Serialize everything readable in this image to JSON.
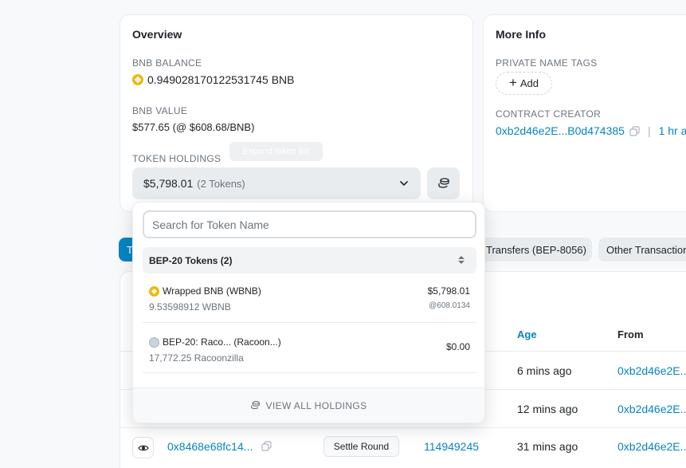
{
  "overview": {
    "title": "Overview",
    "bnb_balance_label": "BNB BALANCE",
    "bnb_balance": "0.949028170122531745 BNB",
    "bnb_value_label": "BNB VALUE",
    "bnb_value": "$577.65 (@ $608.68/BNB)",
    "token_holdings_label": "TOKEN HOLDINGS",
    "tooltip_ghost": "Expand token list",
    "holdings_value": "$5,798.01",
    "holdings_count": "(2 Tokens)"
  },
  "more_info": {
    "title": "More Info",
    "private_tags_label": "PRIVATE NAME TAGS",
    "add_label": "Add",
    "contract_creator_label": "CONTRACT CREATOR",
    "creator_address": "0xb2d46e2E...B0d474385",
    "creator_time": "1 hr a"
  },
  "tabs": {
    "active": "T",
    "bep8056": "Transfers (BEP-8056)",
    "other": "Other Transactions"
  },
  "table": {
    "headers": {
      "age": "Age",
      "from": "From"
    },
    "rows": [
      {
        "age": "6 mins ago",
        "from": "0xb2d46e2E..."
      },
      {
        "age": "12 mins ago",
        "from": "0xb2d46e2E..."
      },
      {
        "txhash": "0x8468e68fc14...",
        "method": "Settle Round",
        "block": "114949245",
        "age": "31 mins ago",
        "from": "0xb2d46e2E..."
      }
    ]
  },
  "dropdown": {
    "search_placeholder": "Search for Token Name",
    "group_title": "BEP-20 Tokens (2)",
    "tokens": [
      {
        "name": "Wrapped BNB (WBNB)",
        "qty": "9.53598912 WBNB",
        "usd": "$5,798.01",
        "rate": "@608.0134"
      },
      {
        "name": "BEP-20: Raco... (Racoon...)",
        "qty": "17,772.25 Racoonzilla",
        "usd": "$0.00",
        "rate": ""
      }
    ],
    "footer": "VIEW ALL HOLDINGS"
  },
  "colors": {
    "accent": "#0784c3",
    "bnb": "#f0b90b"
  }
}
